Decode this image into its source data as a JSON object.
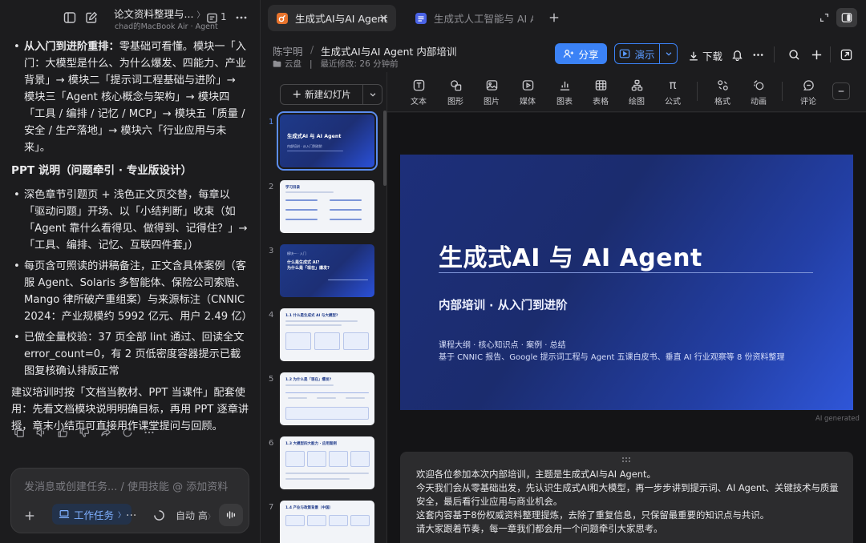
{
  "chat": {
    "title": "论文资料整理与...",
    "subtitle": "chad的MacBook Air · Agent",
    "count": "1",
    "bullet_top": {
      "bold": "从入门到进阶重排：",
      "text": "零基础可看懂。模块一「入门：大模型是什么、为什么爆发、四能力、产业背景」→ 模块二「提示词工程基础与进阶」→ 模块三「Agent 核心概念与架构」→ 模块四「工具 / 编排 / 记忆 / MCP」→ 模块五「质量 / 安全 / 生产落地」→ 模块六「行业应用与未来」。"
    },
    "heading": "PPT 说明（问题牵引 · 专业版设计）",
    "bullets": [
      "深色章节引题页 + 浅色正文页交替，每章以「驱动问题」开场、以「小结判断」收束（如「Agent 靠什么看得见、做得到、记得住？」→「工具、编排、记忆、互联四件套」）",
      "每页含可照读的讲稿备注，正文含具体案例（客服 Agent、Solaris 多智能体、保险公司索赔、Mango 律所破产重组案）与来源标注（CNNIC 2024：产业规模约 5992 亿元、用户 2.49 亿）",
      "已做全量校验：37 页全部 lint 通过、回读全文 error_count=0，有 2 页低密度容器提示已截图复核确认排版正常"
    ],
    "closing": "建议培训时按「文档当教材、PPT 当课件」配套使用：先看文档模块说明明确目标，再用 PPT 逐章讲授，章末小结页可直接用作课堂提问与回顾。",
    "composer_placeholder": "发消息或创建任务... / 使用技能 @ 添加资料",
    "task_chip": "工作任务",
    "auto_label": "自动 高"
  },
  "tabs": [
    {
      "label": "生成式AI与AI Agent",
      "active": true
    },
    {
      "label": "生成式人工智能与 AI A",
      "active": false
    }
  ],
  "doc": {
    "owner": "陈宇明",
    "sep": "/",
    "title": "生成式AI与AI Agent 内部培训",
    "location": "云盘",
    "modified": "最近修改: 26 分钟前",
    "share_label": "分享",
    "present_label": "演示",
    "download_label": "下载"
  },
  "slides_panel": {
    "new_slide_label": "新建幻灯片",
    "numbers": [
      "1",
      "2",
      "3",
      "4",
      "5",
      "6",
      "7"
    ],
    "thumb1": {
      "title": "生成式AI 与 AI Agent",
      "sub": "内部培训 · 从入门到进阶"
    },
    "thumb2": {
      "heading": "学习目录"
    },
    "thumb3": {
      "title": "什么是生成式 AI?\n为什么是「现在」爆发?",
      "sub": "模块一 · 入门"
    },
    "thumb4": {
      "heading": "1.1 什么是生成式 AI 与大模型?"
    },
    "thumb5": {
      "heading": "1.2 为什么是「现在」爆发?"
    },
    "thumb6": {
      "heading": "1.3 大模型四大能力 · 应用案例"
    },
    "thumb7": {
      "heading": "1.4 产业与政策背景（中国）"
    }
  },
  "toolbar": {
    "items": [
      "文本",
      "图形",
      "图片",
      "媒体",
      "图表",
      "表格",
      "绘图",
      "公式",
      "格式",
      "动画",
      "评论"
    ]
  },
  "slide": {
    "title": "生成式AI 与 AI Agent",
    "subtitle": "内部培训 · 从入门到进阶",
    "desc1": "课程大纲 · 核心知识点 · 案例 · 总结",
    "desc2": "基于 CNNIC 报告、Google 提示词工程与 Agent 五课白皮书、垂直 AI 行业观察等 8 份资料整理"
  },
  "ai_generated": "AI generated",
  "notes": [
    "欢迎各位参加本次内部培训，主题是生成式AI与AI Agent。",
    "今天我们会从零基础出发，先认识生成式AI和大模型，再一步步讲到提示词、AI Agent、关键技术与质量",
    "安全，最后看行业应用与商业机会。",
    "这套内容基于8份权威资料整理提炼，去除了重复信息，只保留最重要的知识点与共识。",
    "请大家跟着节奏，每一章我们都会用一个问题牵引大家思考。"
  ],
  "colors": {
    "accent": "#3b82f6",
    "slide_bg": "#1e3a8a",
    "panel": "#1c1c1e"
  }
}
